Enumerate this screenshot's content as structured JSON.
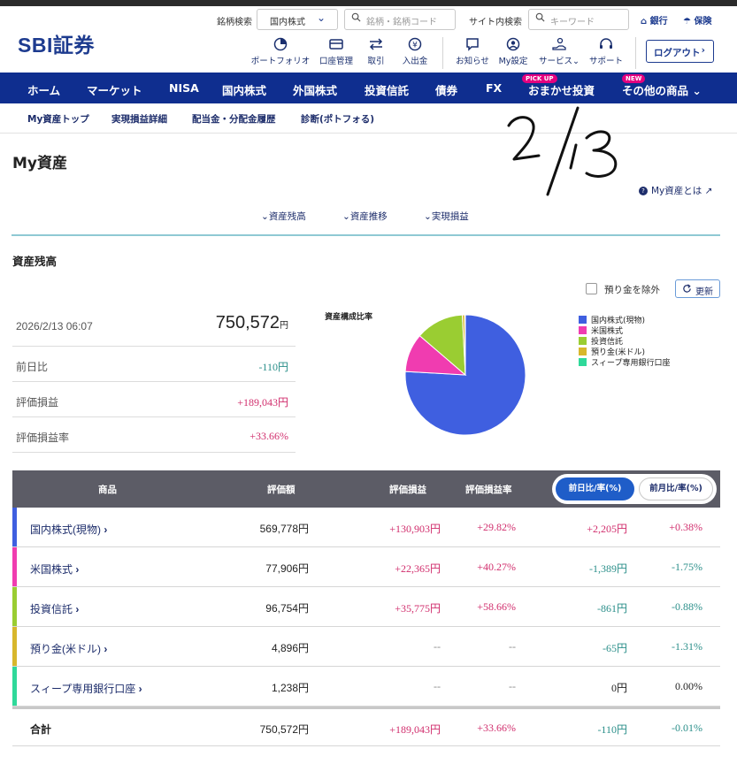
{
  "header": {
    "logo": "SBI証券",
    "stock_search_label": "銘柄検索",
    "stock_select_value": "国内株式",
    "stock_search_placeholder": "銘柄・銘柄コード",
    "site_search_label": "サイト内検索",
    "site_search_placeholder": "キーワード",
    "bank_label": "銀行",
    "insurance_label": "保険",
    "icons": [
      {
        "label": "ポートフォリオ",
        "icon": "portfolio-icon"
      },
      {
        "label": "口座管理",
        "icon": "card-icon"
      },
      {
        "label": "取引",
        "icon": "transfer-arrows-icon"
      },
      {
        "label": "入出金",
        "icon": "yen-coin-icon"
      },
      {
        "label": "お知らせ",
        "icon": "message-icon"
      },
      {
        "label": "My設定",
        "icon": "user-icon"
      },
      {
        "label": "サービス",
        "icon": "hand-coin-icon"
      },
      {
        "label": "サポート",
        "icon": "headset-icon"
      }
    ],
    "logout_label": "ログアウト"
  },
  "nav": {
    "items": [
      "ホーム",
      "マーケット",
      "NISA",
      "国内株式",
      "外国株式",
      "投資信託",
      "債券",
      "FX",
      "おまかせ投資",
      "その他の商品"
    ],
    "pickup_badge": "PICK UP",
    "new_badge": "NEW"
  },
  "subnav": {
    "items": [
      "My資産トップ",
      "実現損益詳細",
      "配当金・分配金履歴",
      "診断(ポトフォる)"
    ]
  },
  "annotation": "2/13",
  "page": {
    "title": "My資産",
    "about_link": "My資産とは",
    "anchors": [
      "資産残高",
      "資産推移",
      "実現損益"
    ]
  },
  "balance": {
    "section_title": "資産残高",
    "exclude_deposit_label": "預り金を除外",
    "refresh_label": "更新",
    "datetime": "2026/2/13 06:07",
    "total_value": "750,572",
    "yen_unit": "円",
    "rows": [
      {
        "label": "前日比",
        "value": "-110円",
        "tone": "neg"
      },
      {
        "label": "評価損益",
        "value": "+189,043円",
        "tone": "pos"
      },
      {
        "label": "評価損益率",
        "value": "+33.66%",
        "tone": "pos"
      }
    ],
    "pie_title": "資産構成比率"
  },
  "chart_data": {
    "type": "pie",
    "title": "資産構成比率",
    "labels": [
      "国内株式(現物)",
      "米国株式",
      "投資信託",
      "預り金(米ドル)",
      "スィープ専用銀行口座"
    ],
    "values": [
      569778,
      77906,
      96754,
      4896,
      1238
    ],
    "colors": [
      "#3f5fe0",
      "#f03cb0",
      "#9acd32",
      "#d8b72c",
      "#2fd99a"
    ],
    "legend_position": "right"
  },
  "table": {
    "headers": [
      "商品",
      "評価額",
      "評価損益",
      "評価損益率"
    ],
    "toggle_active": "前日比/率(%)",
    "toggle_inactive": "前月比/率(%)",
    "rows": [
      {
        "name": "国内株式(現物)",
        "value": "569,778円",
        "pl": "+130,903円",
        "pl_rate": "+29.82%",
        "day": "+2,205円",
        "day_rate": "+0.38%",
        "pl_tone": "pos",
        "day_tone": "pos",
        "rate_tone": "pos"
      },
      {
        "name": "米国株式",
        "value": "77,906円",
        "pl": "+22,365円",
        "pl_rate": "+40.27%",
        "day": "-1,389円",
        "day_rate": "-1.75%",
        "pl_tone": "pos",
        "day_tone": "neg",
        "rate_tone": "neg"
      },
      {
        "name": "投資信託",
        "value": "96,754円",
        "pl": "+35,775円",
        "pl_rate": "+58.66%",
        "day": "-861円",
        "day_rate": "-0.88%",
        "pl_tone": "pos",
        "day_tone": "neg",
        "rate_tone": "neg"
      },
      {
        "name": "預り金(米ドル)",
        "value": "4,896円",
        "pl": "--",
        "pl_rate": "--",
        "day": "-65円",
        "day_rate": "-1.31%",
        "pl_tone": "dash",
        "day_tone": "neg",
        "rate_tone": "neg"
      },
      {
        "name": "スィープ専用銀行口座",
        "value": "1,238円",
        "pl": "--",
        "pl_rate": "--",
        "day": "0円",
        "day_rate": "0.00%",
        "pl_tone": "dash",
        "day_tone": "neu",
        "rate_tone": "neu"
      }
    ],
    "total": {
      "name": "合計",
      "value": "750,572円",
      "pl": "+189,043円",
      "pl_rate": "+33.66%",
      "day": "-110円",
      "day_rate": "-0.01%"
    }
  }
}
